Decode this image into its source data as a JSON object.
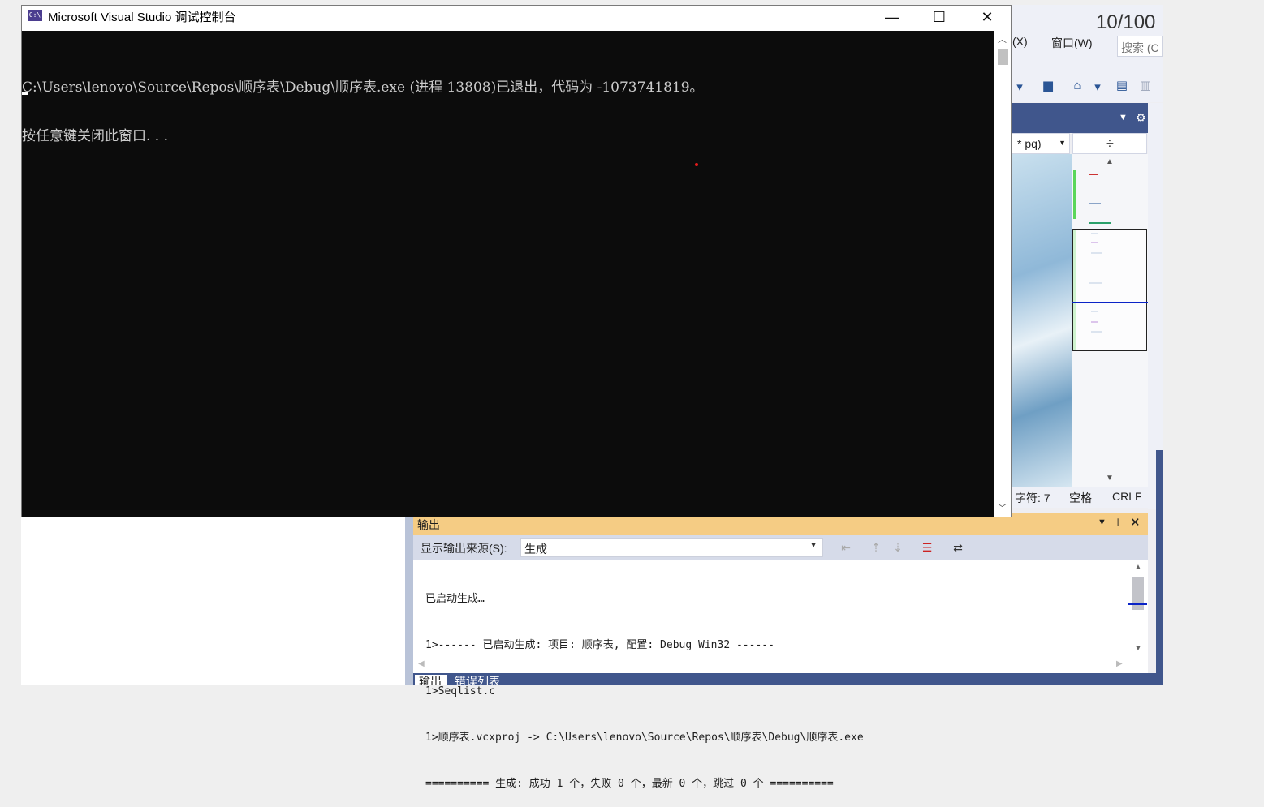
{
  "console": {
    "title": "Microsoft Visual Studio 调试控制台",
    "icon_text": "C:\\",
    "lines": [
      "C:\\Users\\lenovo\\Source\\Repos\\顺序表\\Debug\\顺序表.exe (进程 13808)已退出，代码为 -1073741819。",
      "按任意键关闭此窗口. . ."
    ],
    "minimize_glyph": "—",
    "maximize_glyph": "☐",
    "close_glyph": "✕"
  },
  "vs": {
    "counter": "10/100",
    "menu": {
      "item1": "(X)",
      "item2": "窗口(W)"
    },
    "search_placeholder": "搜索 (C",
    "editor_tab": "* pq)",
    "split_glyph": "÷",
    "status": {
      "char": "字符: 7",
      "spaces": "空格",
      "eol": "CRLF"
    },
    "output": {
      "title": "输出",
      "source_label": "显示输出来源(S):",
      "source_value": "生成",
      "lines": [
        "已启动生成…",
        "1>------ 已启动生成: 项目: 顺序表, 配置: Debug Win32 ------",
        "1>Seqlist.c",
        "1>顺序表.vcxproj -> C:\\Users\\lenovo\\Source\\Repos\\顺序表\\Debug\\顺序表.exe",
        "========== 生成: 成功 1 个，失败 0 个，最新 0 个，跳过 0 个 =========="
      ],
      "tabs": [
        "输出",
        "错误列表"
      ]
    }
  },
  "colors": {
    "console_bg": "#0c0c0c",
    "output_header": "#f5cc84",
    "vs_navy": "#40568c"
  }
}
